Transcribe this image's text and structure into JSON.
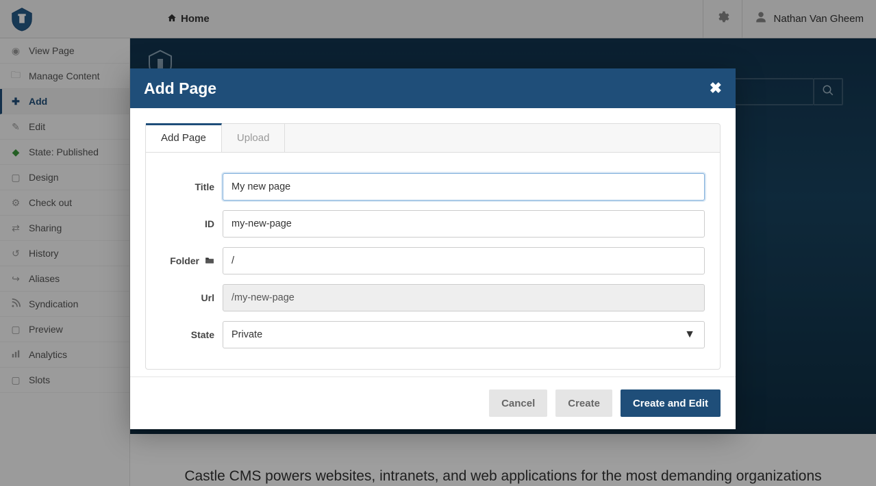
{
  "topbar": {
    "breadcrumb_label": "Home",
    "user_name": "Nathan Van Gheem"
  },
  "sidebar": {
    "items": [
      {
        "icon": "eye-icon",
        "label": "View Page"
      },
      {
        "icon": "folder-icon",
        "label": "Manage Content"
      },
      {
        "icon": "plus-icon",
        "label": "Add"
      },
      {
        "icon": "pencil-icon",
        "label": "Edit"
      },
      {
        "icon": "state-icon",
        "label": "State: Published"
      },
      {
        "icon": "design-icon",
        "label": "Design"
      },
      {
        "icon": "checkout-icon",
        "label": "Check out"
      },
      {
        "icon": "sharing-icon",
        "label": "Sharing"
      },
      {
        "icon": "history-icon",
        "label": "History"
      },
      {
        "icon": "aliases-icon",
        "label": "Aliases"
      },
      {
        "icon": "rss-icon",
        "label": "Syndication"
      },
      {
        "icon": "preview-icon",
        "label": "Preview"
      },
      {
        "icon": "analytics-icon",
        "label": "Analytics"
      },
      {
        "icon": "slots-icon",
        "label": "Slots"
      }
    ]
  },
  "hero": {
    "tagline_partial": "Castle CMS powers websites, intranets, and web applications for the most demanding organizations"
  },
  "modal": {
    "title": "Add Page",
    "tabs": {
      "add_page": "Add Page",
      "upload": "Upload"
    },
    "fields": {
      "title_label": "Title",
      "title_value": "My new page",
      "id_label": "ID",
      "id_value": "my-new-page",
      "folder_label": "Folder",
      "folder_value": "/",
      "url_label": "Url",
      "url_value": "/my-new-page",
      "state_label": "State",
      "state_value": "Private"
    },
    "buttons": {
      "cancel": "Cancel",
      "create": "Create",
      "create_and_edit": "Create and Edit"
    }
  },
  "colors": {
    "primary": "#1f4e79"
  }
}
